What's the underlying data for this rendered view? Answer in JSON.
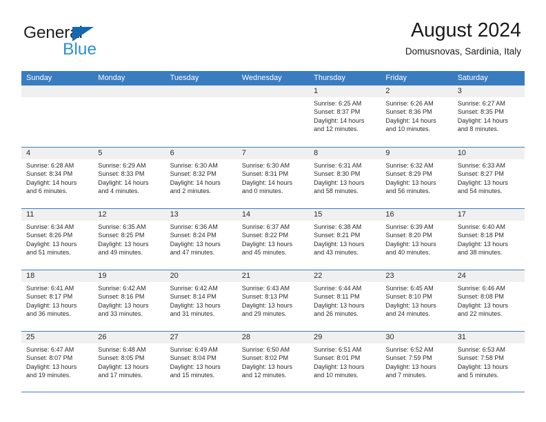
{
  "brand": {
    "word1": "General",
    "word2": "Blue",
    "triangle_color": "#1268b3",
    "blue_color": "#2b8fd4"
  },
  "header": {
    "title": "August 2024",
    "subtitle": "Domusnovas, Sardinia, Italy"
  },
  "theme": {
    "header_blue": "#3a7cc0",
    "daynum_band": "#f0f0f0",
    "text": "#2b2b2b"
  },
  "weekday_headers": [
    "Sunday",
    "Monday",
    "Tuesday",
    "Wednesday",
    "Thursday",
    "Friday",
    "Saturday"
  ],
  "weeks": [
    [
      {
        "day": "",
        "lines": []
      },
      {
        "day": "",
        "lines": []
      },
      {
        "day": "",
        "lines": []
      },
      {
        "day": "",
        "lines": []
      },
      {
        "day": "1",
        "lines": [
          "Sunrise: 6:25 AM",
          "Sunset: 8:37 PM",
          "Daylight: 14 hours",
          "and 12 minutes."
        ]
      },
      {
        "day": "2",
        "lines": [
          "Sunrise: 6:26 AM",
          "Sunset: 8:36 PM",
          "Daylight: 14 hours",
          "and 10 minutes."
        ]
      },
      {
        "day": "3",
        "lines": [
          "Sunrise: 6:27 AM",
          "Sunset: 8:35 PM",
          "Daylight: 14 hours",
          "and 8 minutes."
        ]
      }
    ],
    [
      {
        "day": "4",
        "lines": [
          "Sunrise: 6:28 AM",
          "Sunset: 8:34 PM",
          "Daylight: 14 hours",
          "and 6 minutes."
        ]
      },
      {
        "day": "5",
        "lines": [
          "Sunrise: 6:29 AM",
          "Sunset: 8:33 PM",
          "Daylight: 14 hours",
          "and 4 minutes."
        ]
      },
      {
        "day": "6",
        "lines": [
          "Sunrise: 6:30 AM",
          "Sunset: 8:32 PM",
          "Daylight: 14 hours",
          "and 2 minutes."
        ]
      },
      {
        "day": "7",
        "lines": [
          "Sunrise: 6:30 AM",
          "Sunset: 8:31 PM",
          "Daylight: 14 hours",
          "and 0 minutes."
        ]
      },
      {
        "day": "8",
        "lines": [
          "Sunrise: 6:31 AM",
          "Sunset: 8:30 PM",
          "Daylight: 13 hours",
          "and 58 minutes."
        ]
      },
      {
        "day": "9",
        "lines": [
          "Sunrise: 6:32 AM",
          "Sunset: 8:29 PM",
          "Daylight: 13 hours",
          "and 56 minutes."
        ]
      },
      {
        "day": "10",
        "lines": [
          "Sunrise: 6:33 AM",
          "Sunset: 8:27 PM",
          "Daylight: 13 hours",
          "and 54 minutes."
        ]
      }
    ],
    [
      {
        "day": "11",
        "lines": [
          "Sunrise: 6:34 AM",
          "Sunset: 8:26 PM",
          "Daylight: 13 hours",
          "and 51 minutes."
        ]
      },
      {
        "day": "12",
        "lines": [
          "Sunrise: 6:35 AM",
          "Sunset: 8:25 PM",
          "Daylight: 13 hours",
          "and 49 minutes."
        ]
      },
      {
        "day": "13",
        "lines": [
          "Sunrise: 6:36 AM",
          "Sunset: 8:24 PM",
          "Daylight: 13 hours",
          "and 47 minutes."
        ]
      },
      {
        "day": "14",
        "lines": [
          "Sunrise: 6:37 AM",
          "Sunset: 8:22 PM",
          "Daylight: 13 hours",
          "and 45 minutes."
        ]
      },
      {
        "day": "15",
        "lines": [
          "Sunrise: 6:38 AM",
          "Sunset: 8:21 PM",
          "Daylight: 13 hours",
          "and 43 minutes."
        ]
      },
      {
        "day": "16",
        "lines": [
          "Sunrise: 6:39 AM",
          "Sunset: 8:20 PM",
          "Daylight: 13 hours",
          "and 40 minutes."
        ]
      },
      {
        "day": "17",
        "lines": [
          "Sunrise: 6:40 AM",
          "Sunset: 8:18 PM",
          "Daylight: 13 hours",
          "and 38 minutes."
        ]
      }
    ],
    [
      {
        "day": "18",
        "lines": [
          "Sunrise: 6:41 AM",
          "Sunset: 8:17 PM",
          "Daylight: 13 hours",
          "and 36 minutes."
        ]
      },
      {
        "day": "19",
        "lines": [
          "Sunrise: 6:42 AM",
          "Sunset: 8:16 PM",
          "Daylight: 13 hours",
          "and 33 minutes."
        ]
      },
      {
        "day": "20",
        "lines": [
          "Sunrise: 6:42 AM",
          "Sunset: 8:14 PM",
          "Daylight: 13 hours",
          "and 31 minutes."
        ]
      },
      {
        "day": "21",
        "lines": [
          "Sunrise: 6:43 AM",
          "Sunset: 8:13 PM",
          "Daylight: 13 hours",
          "and 29 minutes."
        ]
      },
      {
        "day": "22",
        "lines": [
          "Sunrise: 6:44 AM",
          "Sunset: 8:11 PM",
          "Daylight: 13 hours",
          "and 26 minutes."
        ]
      },
      {
        "day": "23",
        "lines": [
          "Sunrise: 6:45 AM",
          "Sunset: 8:10 PM",
          "Daylight: 13 hours",
          "and 24 minutes."
        ]
      },
      {
        "day": "24",
        "lines": [
          "Sunrise: 6:46 AM",
          "Sunset: 8:08 PM",
          "Daylight: 13 hours",
          "and 22 minutes."
        ]
      }
    ],
    [
      {
        "day": "25",
        "lines": [
          "Sunrise: 6:47 AM",
          "Sunset: 8:07 PM",
          "Daylight: 13 hours",
          "and 19 minutes."
        ]
      },
      {
        "day": "26",
        "lines": [
          "Sunrise: 6:48 AM",
          "Sunset: 8:05 PM",
          "Daylight: 13 hours",
          "and 17 minutes."
        ]
      },
      {
        "day": "27",
        "lines": [
          "Sunrise: 6:49 AM",
          "Sunset: 8:04 PM",
          "Daylight: 13 hours",
          "and 15 minutes."
        ]
      },
      {
        "day": "28",
        "lines": [
          "Sunrise: 6:50 AM",
          "Sunset: 8:02 PM",
          "Daylight: 13 hours",
          "and 12 minutes."
        ]
      },
      {
        "day": "29",
        "lines": [
          "Sunrise: 6:51 AM",
          "Sunset: 8:01 PM",
          "Daylight: 13 hours",
          "and 10 minutes."
        ]
      },
      {
        "day": "30",
        "lines": [
          "Sunrise: 6:52 AM",
          "Sunset: 7:59 PM",
          "Daylight: 13 hours",
          "and 7 minutes."
        ]
      },
      {
        "day": "31",
        "lines": [
          "Sunrise: 6:53 AM",
          "Sunset: 7:58 PM",
          "Daylight: 13 hours",
          "and 5 minutes."
        ]
      }
    ]
  ]
}
